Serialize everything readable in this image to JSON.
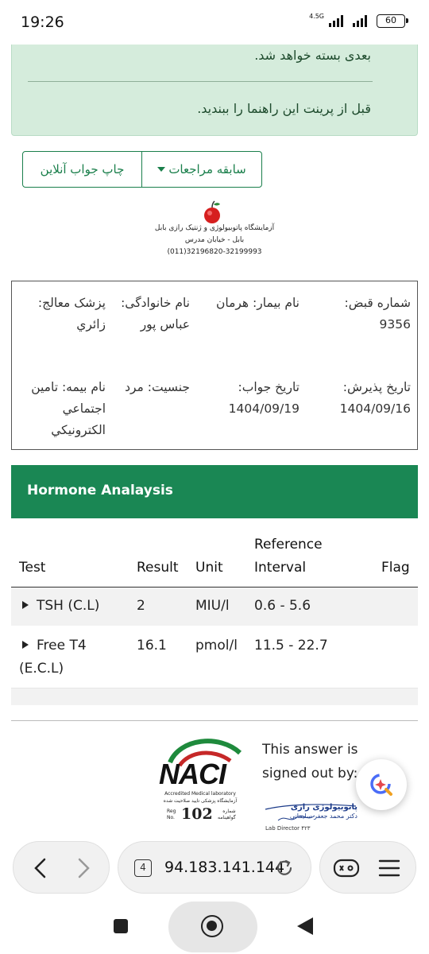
{
  "status_bar": {
    "time": "19:26",
    "network": "4.5G",
    "battery": "60"
  },
  "notice": {
    "line1": "بعدی بسته خواهد شد.",
    "line2": "قبل از پرینت این راهنما را ببندید."
  },
  "buttons": {
    "print_online": "چاپ جواب آنلاین",
    "visit_history": "سابقه مراجعات"
  },
  "lab": {
    "name": "آزمایشگاه پاتوبیولوژی و ژنتیک رازی بابل",
    "address": "بابل - خیابان مدرس",
    "phone": "(011)32196820-32199993"
  },
  "patient_info": {
    "reception_no_label": "شماره قبض:",
    "reception_no": "9356",
    "patient_name_label": "نام بیمار:",
    "patient_name": "هرمان",
    "family_label": "نام خانوادگی:",
    "family": "عباس پور",
    "doctor_label": "پزشک معالج:",
    "doctor": "زائري",
    "admit_date_label": "تاریخ پذیرش:",
    "admit_date": "1404/09/16",
    "answer_date_label": "تاریخ جواب:",
    "answer_date": "1404/09/19",
    "gender_label": "جنسیت:",
    "gender": "مرد",
    "insurance_label": "نام بیمه:",
    "insurance": "تامین اجتماعي الكترونيكي"
  },
  "panel": {
    "title": "Hormone Analaysis"
  },
  "table": {
    "headers": {
      "test": "Test",
      "result": "Result",
      "unit": "Unit",
      "reference_line1": "Reference",
      "reference_line2": "Interval",
      "flag": "Flag"
    },
    "rows": [
      {
        "test": "TSH (C.L)",
        "test_line2": "",
        "result": "2",
        "unit": "MIU/l",
        "reference": "0.6 - 5.6",
        "flag": ""
      },
      {
        "test": "Free T4",
        "test_line2": "(E.C.L)",
        "result": "16.1",
        "unit": "pmol/l",
        "reference": "11.5 - 22.7",
        "flag": ""
      }
    ]
  },
  "footer": {
    "accreditation_logo": "NACI",
    "accreditation_sub": "Accredited Medical laboratory",
    "accreditation_sub_fa": "آزمایشگاه پزشکی تایید صلاحیت شده",
    "reg_label": "Reg\nNo.",
    "reg_number": "102",
    "reg_label_fa": "شماره\nگواهینامه",
    "signed_out_text": "This answer is signed out by:",
    "signature_name": "پاتوبیولوژی رازی",
    "signature_title": "دکتر محمد جعفر سلیمانی",
    "lab_director": "Lab Director ۴۲۳"
  },
  "browser": {
    "tab_count": "4",
    "url": "94.183.141.144"
  },
  "icons": {
    "back": "chevron-left-icon",
    "forward": "chevron-right-icon",
    "reload": "reload-icon",
    "game": "gamepad-icon",
    "menu": "hamburger-menu-icon",
    "assistant": "assistant-icon"
  },
  "colors": {
    "accent_green": "#1a8754",
    "notice_bg": "#d5ecdc"
  }
}
